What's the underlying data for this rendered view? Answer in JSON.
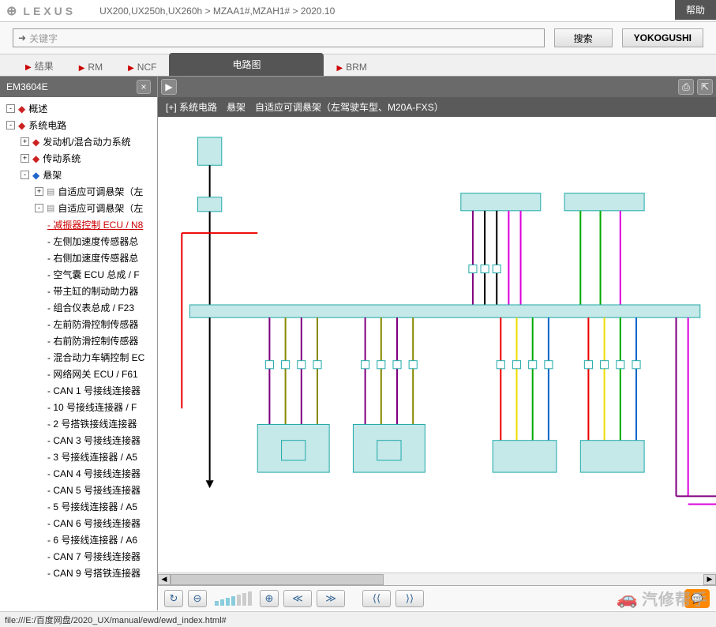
{
  "header": {
    "logo": "LEXUS",
    "breadcrumb": "UX200,UX250h,UX260h > MZAA1#,MZAH1# > 2020.10",
    "help": "帮助"
  },
  "search": {
    "placeholder": "关键字",
    "search_btn": "搜索",
    "yoko_btn": "YOKOGUSHI"
  },
  "tabs": {
    "result": "结果",
    "rm": "RM",
    "ncf": "NCF",
    "ewd": "电路图",
    "brm": "BRM"
  },
  "sidebar": {
    "title": "EM3604E",
    "items": [
      {
        "level": 1,
        "exp": "-",
        "icon": "book-r",
        "label": "概述"
      },
      {
        "level": 1,
        "exp": "-",
        "icon": "book-r",
        "label": "系统电路"
      },
      {
        "level": 2,
        "exp": "+",
        "icon": "book-r",
        "label": "发动机/混合动力系统"
      },
      {
        "level": 2,
        "exp": "+",
        "icon": "book-r",
        "label": "传动系统"
      },
      {
        "level": 2,
        "exp": "-",
        "icon": "book-b",
        "label": "悬架"
      },
      {
        "level": 3,
        "exp": "+",
        "icon": "doc",
        "label": "自适应可调悬架（左"
      },
      {
        "level": 3,
        "exp": "-",
        "icon": "doc",
        "label": "自适应可调悬架（左"
      },
      {
        "level": 4,
        "active": true,
        "label": "- 减振器控制 ECU / N8"
      },
      {
        "level": 4,
        "label": "- 左侧加速度传感器总"
      },
      {
        "level": 4,
        "label": "- 右侧加速度传感器总"
      },
      {
        "level": 4,
        "label": "- 空气囊 ECU 总成 / F"
      },
      {
        "level": 4,
        "label": "- 带主缸的制动助力器"
      },
      {
        "level": 4,
        "label": "- 组合仪表总成 / F23"
      },
      {
        "level": 4,
        "label": "- 左前防滑控制传感器"
      },
      {
        "level": 4,
        "label": "- 右前防滑控制传感器"
      },
      {
        "level": 4,
        "label": "- 混合动力车辆控制 EC"
      },
      {
        "level": 4,
        "label": "- 网络网关 ECU / F61"
      },
      {
        "level": 4,
        "label": "- CAN 1 号接线连接器"
      },
      {
        "level": 4,
        "label": "- 10 号接线连接器 / F"
      },
      {
        "level": 4,
        "label": "- 2 号搭铁接线连接器"
      },
      {
        "level": 4,
        "label": "- CAN 3 号接线连接器"
      },
      {
        "level": 4,
        "label": "- 3 号接线连接器 / A5"
      },
      {
        "level": 4,
        "label": "- CAN 4 号接线连接器"
      },
      {
        "level": 4,
        "label": "- CAN 5 号接线连接器"
      },
      {
        "level": 4,
        "label": "- 5 号接线连接器 / A5"
      },
      {
        "level": 4,
        "label": "- CAN 6 号接线连接器"
      },
      {
        "level": 4,
        "label": "- 6 号接线连接器 / A6"
      },
      {
        "level": 4,
        "label": "- CAN 7 号接线连接器"
      },
      {
        "level": 4,
        "label": "- CAN 9 号搭铁连接器"
      }
    ]
  },
  "diagram": {
    "title": "[+] 系统电路　悬架　自适应可调悬架（左驾驶车型、M20A-FXS）"
  },
  "status": "file:///E:/百度网盘/2020_UX/manual/ewd/ewd_index.html#",
  "watermark": "汽修帮手"
}
